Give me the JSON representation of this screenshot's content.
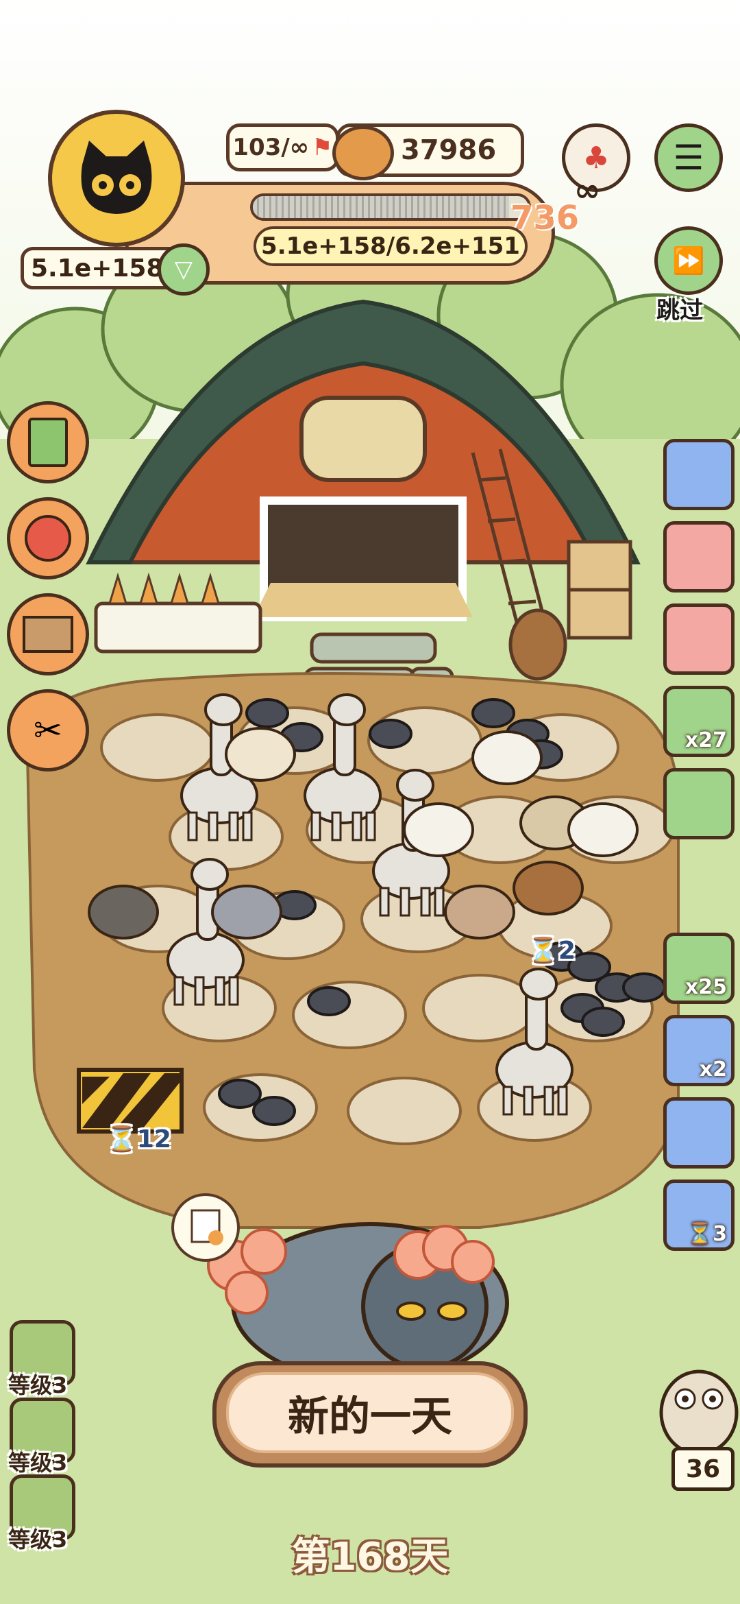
{
  "hud": {
    "level_count": "103/∞",
    "coins": "37986",
    "wealth": "5.1e+158",
    "progress_text": "5.1e+158/6.2e+151",
    "progress_badge": "736",
    "progress_fraction": 0.93
  },
  "skip": {
    "label": "跳过"
  },
  "right_panel": [
    {
      "name": "barn-tile",
      "badge": "",
      "color": "#8fb4f0"
    },
    {
      "name": "rope-tile",
      "badge": "",
      "color": "#f4a8a4"
    },
    {
      "name": "heart-tile",
      "badge": "",
      "color": "#f4a8a4"
    },
    {
      "name": "seed-pack-tile",
      "badge": "x27",
      "color": "#9fd48a"
    },
    {
      "name": "card-tile",
      "badge": "",
      "color": "#9fd48a"
    },
    {
      "name": "pink-animal-tile",
      "badge": "x25",
      "color": "#9fd48a"
    },
    {
      "name": "jar-tile",
      "badge": "x2",
      "color": "#8fb4f0"
    },
    {
      "name": "sheep-tile",
      "badge": "",
      "color": "#8fb4f0"
    },
    {
      "name": "hourglass-tile",
      "badge": "⏳3",
      "color": "#8fb4f0"
    }
  ],
  "levels": [
    {
      "label": "等级3"
    },
    {
      "label": "等级3"
    },
    {
      "label": "等级3"
    }
  ],
  "timers": {
    "moles": "⏳2",
    "roadblock": "⏳12"
  },
  "bird_count": "36",
  "new_day_button": "新的一天",
  "day_label": "第168天",
  "colors": {
    "grass": "#cfe3a6",
    "dirt": "#c59a5c",
    "barn": "#c85a30",
    "roof": "#3f5a4a",
    "accent": "#f0a24a"
  }
}
